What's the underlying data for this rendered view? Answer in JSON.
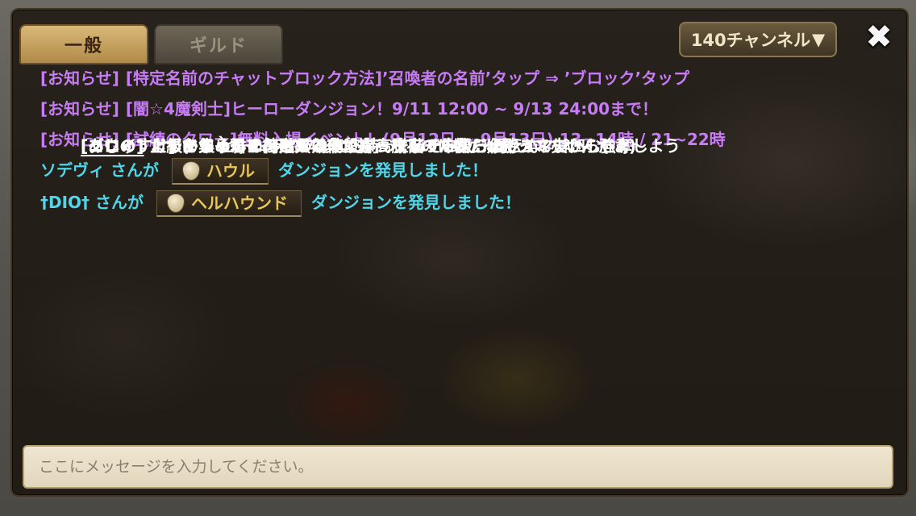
{
  "tabs": [
    {
      "label": "一般",
      "active": true
    },
    {
      "label": "ギルド",
      "active": false
    }
  ],
  "channel": {
    "label": "140チャンネル",
    "arrow": "▼"
  },
  "close_icon": "✖",
  "messages": [
    {
      "type": "notice",
      "name": "[お知らせ]",
      "text": "[特定名前のチャットブロック方法]’召喚者の名前’タップ ⇒ ’ブロック’タップ"
    },
    {
      "type": "notice",
      "name": "[お知らせ]",
      "text": "[闇☆4魔剣士]ヒーローダンジョン！9/11 12:00 ~ 9/13 24:00まで！"
    },
    {
      "type": "notice",
      "name": "[お知らせ]",
      "text": "[試練のタワー]無料入場イベント！(9月12日 ~ 9月13日) 13~14時 / 21~22時"
    },
    {
      "type": "chat",
      "name": "[コウのすけ]",
      "text": "あじゅ君その道具は値段が高騰してるから 買えないよ〜",
      "underline": false
    },
    {
      "type": "chat",
      "name": "[グロイ]",
      "text": "上級　集めるの何階が効率よい？十階で中級一個とかマジ凹む(--;)",
      "underline": true
    },
    {
      "type": "chat",
      "name": "[あじゅ]",
      "text": "だってジャイアンとスネ夫が持ってるのに僕だけ持ってないんだよ〜",
      "underline": true
    },
    {
      "type": "discover",
      "name": "ソデヴィ さんが",
      "dungeon": "ハウル",
      "text": "ダンジョンを発見しました！"
    },
    {
      "type": "chat",
      "name": "[あじゅ]",
      "text": "しずかちゃんに持ってるって言っちゃったんだよ〜",
      "underline": true
    },
    {
      "type": "chat",
      "name": "[コウのすけ]",
      "text": "よし ビームライフルなら持ってるぞ あじゅ君 スネ夫から強奪しよう",
      "underline": false
    },
    {
      "type": "discover",
      "name": "†DIO† さんが",
      "dungeon": "ヘルハウンド",
      "text": "ダンジョンを発見しました！"
    },
    {
      "type": "chat",
      "name": "[あじゅ]",
      "text": "よし！そうしよう！",
      "underline": true
    },
    {
      "type": "chat",
      "name": "[コウのすけ]",
      "text": "(*´ﾛ｀*)ぐへへへ",
      "underline": false
    }
  ],
  "input": {
    "placeholder": "ここにメッセージを入力してください。"
  },
  "colors": {
    "notice": "#c77cf5",
    "discover": "#4fd6ea",
    "chat": "#ffffff",
    "dungeon_chip": "#e9c65a"
  }
}
